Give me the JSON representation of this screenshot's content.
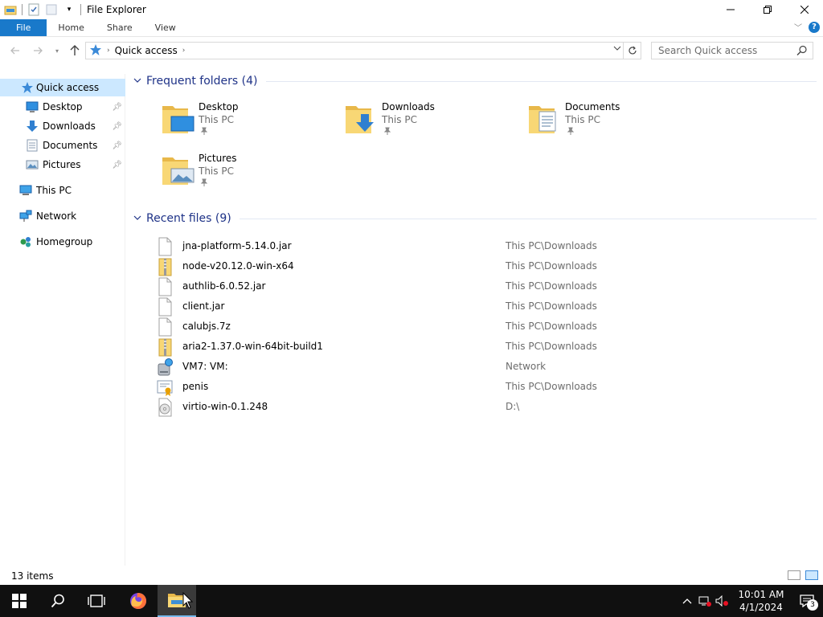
{
  "window": {
    "title": "File Explorer"
  },
  "ribbon": {
    "tabs": [
      "File",
      "Home",
      "Share",
      "View"
    ]
  },
  "address": {
    "path": "Quick access"
  },
  "search": {
    "placeholder": "Search Quick access"
  },
  "nav": {
    "quick_access": "Quick access",
    "pinned": [
      "Desktop",
      "Downloads",
      "Documents",
      "Pictures"
    ],
    "this_pc": "This PC",
    "network": "Network",
    "homegroup": "Homegroup"
  },
  "frequent": {
    "title": "Frequent folders (4)",
    "folders": [
      {
        "name": "Desktop",
        "location": "This PC"
      },
      {
        "name": "Downloads",
        "location": "This PC"
      },
      {
        "name": "Documents",
        "location": "This PC"
      },
      {
        "name": "Pictures",
        "location": "This PC"
      }
    ]
  },
  "recent": {
    "title": "Recent files (9)",
    "files": [
      {
        "name": "jna-platform-5.14.0.jar",
        "location": "This PC\\Downloads",
        "icon": "file-icon"
      },
      {
        "name": "node-v20.12.0-win-x64",
        "location": "This PC\\Downloads",
        "icon": "zip-folder-icon"
      },
      {
        "name": "authlib-6.0.52.jar",
        "location": "This PC\\Downloads",
        "icon": "file-icon"
      },
      {
        "name": "client.jar",
        "location": "This PC\\Downloads",
        "icon": "file-icon"
      },
      {
        "name": "calubjs.7z",
        "location": "This PC\\Downloads",
        "icon": "file-icon"
      },
      {
        "name": "aria2-1.37.0-win-64bit-build1",
        "location": "This PC\\Downloads",
        "icon": "zip-folder-icon"
      },
      {
        "name": "VM7: VM:",
        "location": "Network",
        "icon": "network-drive-icon"
      },
      {
        "name": "penis",
        "location": "This PC\\Downloads",
        "icon": "certificate-icon"
      },
      {
        "name": "virtio-win-0.1.248",
        "location": "D:\\",
        "icon": "disc-image-icon"
      }
    ]
  },
  "status": {
    "items": "13 items"
  },
  "taskbar": {
    "time": "10:01 AM",
    "date": "4/1/2024",
    "notifications": "3"
  },
  "colors": {
    "accent": "#1979ca",
    "group_title": "#1e3287",
    "selected": "#cce8ff",
    "folder": "#f8d775"
  }
}
